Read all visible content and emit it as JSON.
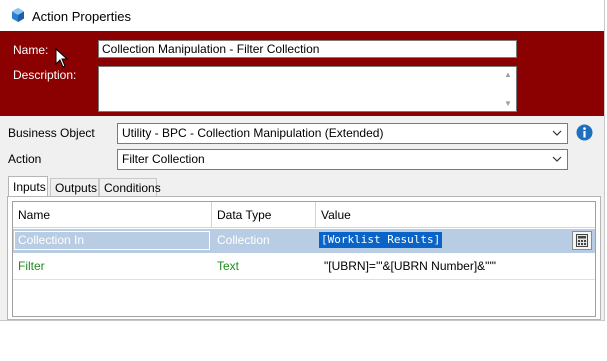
{
  "window": {
    "title": "Action Properties"
  },
  "header": {
    "name_label": "Name:",
    "name_value": "Collection Manipulation - Filter Collection",
    "description_label": "Description:",
    "description_value": ""
  },
  "form": {
    "business_object_label": "Business Object",
    "business_object_value": "Utility - BPC - Collection Manipulation (Extended)",
    "action_label": "Action",
    "action_value": "Filter Collection"
  },
  "tabs": [
    "Inputs",
    "Outputs",
    "Conditions"
  ],
  "grid": {
    "columns": [
      "Name",
      "Data Type",
      "Value"
    ],
    "rows": [
      {
        "name": "Collection In",
        "type": "Collection",
        "value": "[Worklist Results]"
      },
      {
        "name": "Filter",
        "type": "Text",
        "value": "\"[UBRN]='\"&[UBRN Number]&\"'\""
      }
    ]
  },
  "colors": {
    "banner": "#8b0000",
    "selected_row": "#b8cce4",
    "input_text": "#1e8c1e",
    "selection": "#0a64c8"
  },
  "icons": [
    "action-properties-icon",
    "mouse-cursor-icon",
    "chevron-down-icon",
    "info-icon",
    "calculator-icon"
  ]
}
